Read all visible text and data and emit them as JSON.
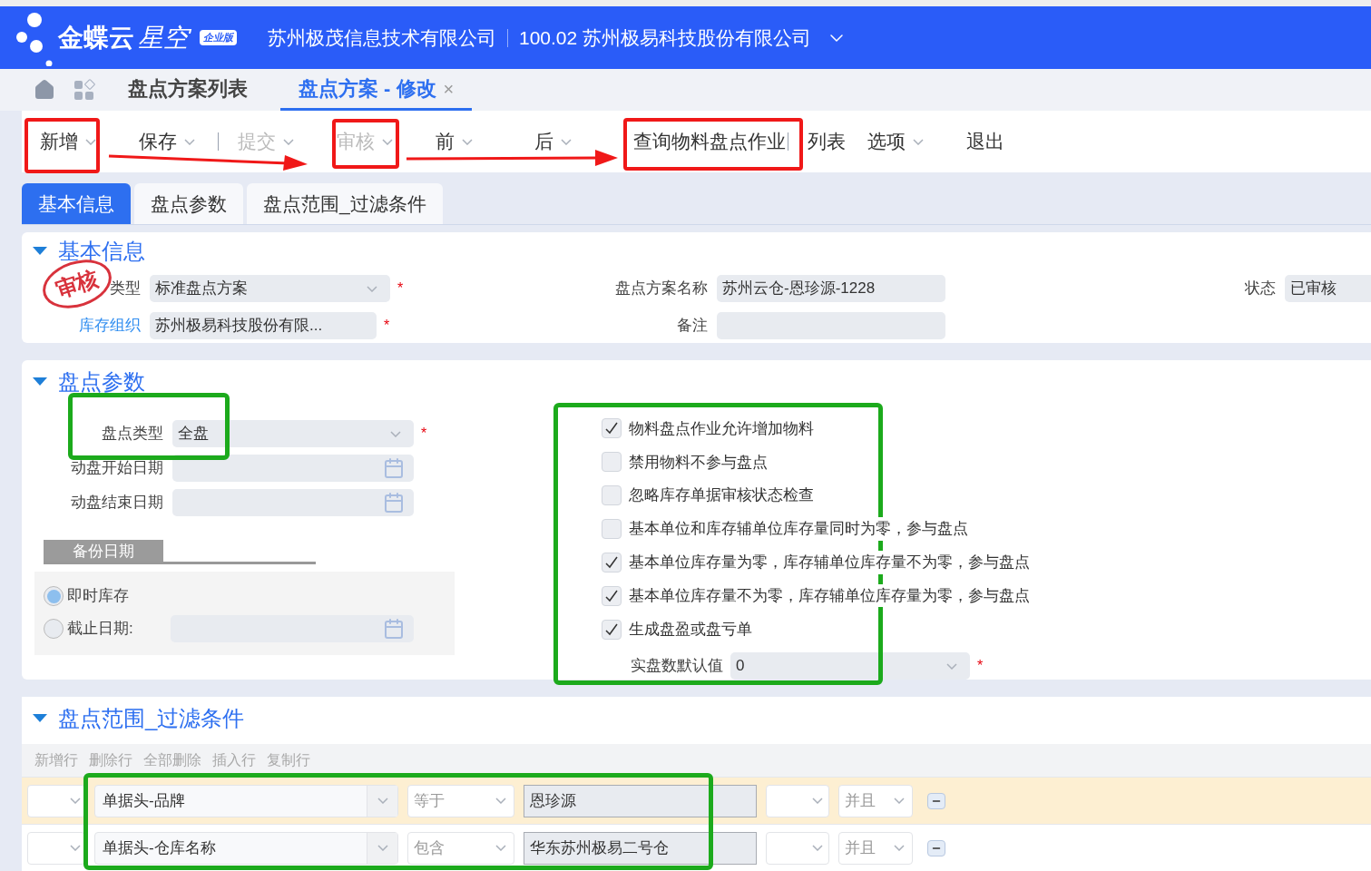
{
  "header": {
    "brand": "金蝶云",
    "brand_sub": "星空",
    "edition": "企业版",
    "company": "苏州极茂信息技术有限公司",
    "org": "100.02 苏州极易科技股份有限公司"
  },
  "page_tabs": [
    {
      "label": "盘点方案列表",
      "selected": false
    },
    {
      "label": "盘点方案 - 修改",
      "selected": true,
      "close": "×"
    }
  ],
  "toolbar": [
    {
      "label": "新增",
      "disabled": false,
      "dropdown": true,
      "separator_before": false
    },
    {
      "label": "保存",
      "disabled": false,
      "dropdown": true,
      "separator_before": false
    },
    {
      "label": "提交",
      "disabled": true,
      "dropdown": true,
      "separator_before": true
    },
    {
      "label": "审核",
      "disabled": true,
      "dropdown": true,
      "separator_before": false
    },
    {
      "label": "前",
      "disabled": false,
      "dropdown": true,
      "separator_before": false
    },
    {
      "label": "后",
      "disabled": false,
      "dropdown": true,
      "separator_before": false
    },
    {
      "label": "查询物料盘点作业",
      "disabled": false,
      "dropdown": false,
      "separator_before": false
    },
    {
      "label": "列表",
      "disabled": false,
      "dropdown": false,
      "separator_before": true
    },
    {
      "label": "选项",
      "disabled": false,
      "dropdown": true,
      "separator_before": false
    },
    {
      "label": "退出",
      "disabled": false,
      "dropdown": false,
      "separator_before": false
    }
  ],
  "form_tabs": [
    {
      "label": "基本信息",
      "selected": true
    },
    {
      "label": "盘点参数",
      "selected": false
    },
    {
      "label": "盘点范围_过滤条件",
      "selected": false
    }
  ],
  "basic": {
    "title": "基本信息",
    "expanded": true,
    "stamp": "审核",
    "rows": [
      [
        {
          "label": "类型",
          "value": "标准盘点方案",
          "kind": "select",
          "required": "*",
          "link": false
        },
        {
          "label": "盘点方案名称",
          "value": "苏州云仓-恩珍源-1228",
          "kind": "text",
          "link": false
        },
        {
          "label": "状态",
          "value": "已审核",
          "kind": "text",
          "link": false
        }
      ],
      [
        {
          "label": "库存组织",
          "value": "苏州极易科技股份有限...",
          "kind": "text",
          "required": "*",
          "link": true
        },
        {
          "label": "备注",
          "kind": "text",
          "link": false
        }
      ]
    ]
  },
  "params": {
    "title": "盘点参数",
    "expanded": true,
    "fields": [
      {
        "label": "盘点类型",
        "value": "全盘",
        "kind": "select",
        "required": "*"
      },
      {
        "label": "动盘开始日期",
        "kind": "date"
      },
      {
        "label": "动盘结束日期",
        "kind": "date"
      }
    ],
    "backup_tab": "备份日期",
    "radios": [
      {
        "label": "即时库存",
        "selected": true,
        "kind": "plain"
      },
      {
        "label": "截止日期:",
        "selected": false,
        "kind": "date"
      }
    ],
    "options": [
      {
        "label": "物料盘点作业允许增加物料",
        "checked": true
      },
      {
        "label": "禁用物料不参与盘点",
        "checked": false
      },
      {
        "label": "忽略库存单据审核状态检查",
        "checked": false
      },
      {
        "label": "基本单位和库存辅单位库存量同时为零，参与盘点",
        "checked": false
      },
      {
        "label": "基本单位库存量为零，库存辅单位库存量不为零，参与盘点",
        "checked": true
      },
      {
        "label": "基本单位库存量不为零，库存辅单位库存量为零，参与盘点",
        "checked": true
      },
      {
        "label": "生成盘盈或盘亏单",
        "checked": true
      }
    ],
    "default_count": {
      "label": "实盘数默认值",
      "value": "0",
      "required": "*"
    }
  },
  "scope": {
    "title": "盘点范围_过滤条件",
    "expanded": true,
    "actions": [
      {
        "label": "新增行",
        "disabled": true
      },
      {
        "label": "删除行",
        "disabled": true
      },
      {
        "label": "全部删除",
        "disabled": true
      },
      {
        "label": "插入行",
        "disabled": true
      },
      {
        "label": "复制行",
        "disabled": true
      }
    ],
    "rows": [
      {
        "selected": true,
        "field": "单据头-品牌",
        "operator": "等于",
        "value": "恩珍源",
        "logic": "并且"
      },
      {
        "selected": false,
        "field": "单据头-仓库名称",
        "operator": "包含",
        "value": "华东苏州极易二号仓",
        "logic": "并且"
      }
    ]
  }
}
